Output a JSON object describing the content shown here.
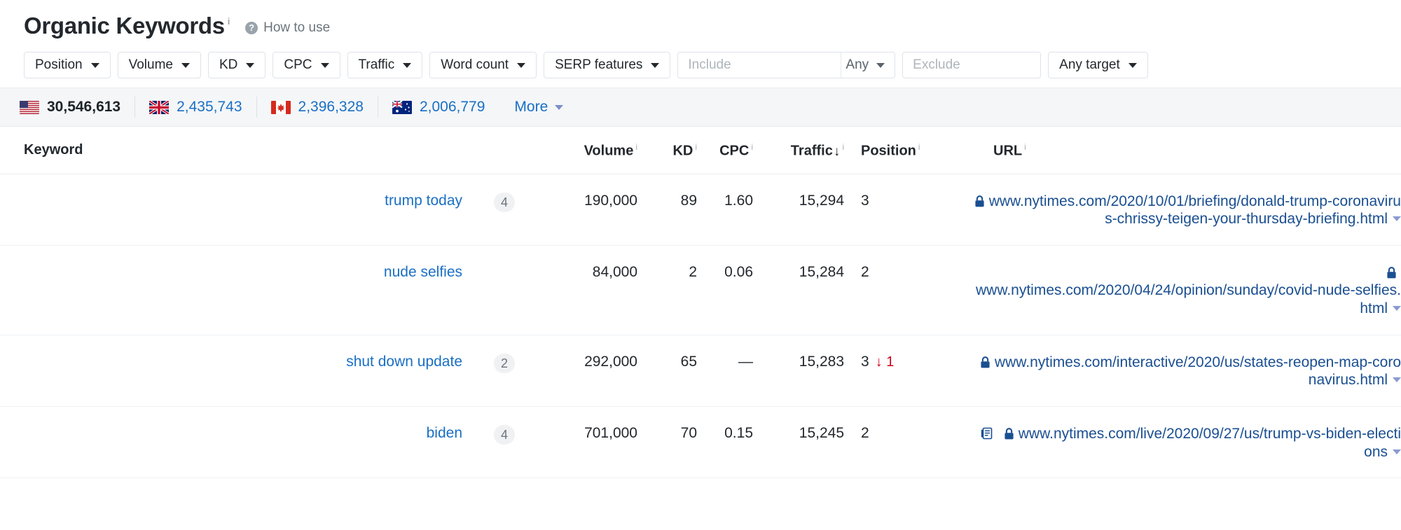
{
  "header": {
    "title": "Organic Keywords",
    "title_info": "i",
    "how_to_use": "How to use",
    "help_icon": "question-mark-icon"
  },
  "filters": {
    "buttons": [
      {
        "label": "Position",
        "name": "position"
      },
      {
        "label": "Volume",
        "name": "volume"
      },
      {
        "label": "KD",
        "name": "kd"
      },
      {
        "label": "CPC",
        "name": "cpc"
      },
      {
        "label": "Traffic",
        "name": "traffic"
      },
      {
        "label": "Word count",
        "name": "word-count"
      },
      {
        "label": "SERP features",
        "name": "serp-features"
      }
    ],
    "include": {
      "placeholder": "Include",
      "value": "",
      "mode": "Any"
    },
    "exclude": {
      "placeholder": "Exclude",
      "value": ""
    },
    "target": {
      "label": "Any target"
    }
  },
  "countries": {
    "items": [
      {
        "code": "US",
        "flag": "flag-us-icon",
        "count": "30,546,613",
        "active": true
      },
      {
        "code": "UK",
        "flag": "flag-uk-icon",
        "count": "2,435,743",
        "active": false
      },
      {
        "code": "CA",
        "flag": "flag-ca-icon",
        "count": "2,396,328",
        "active": false
      },
      {
        "code": "AU",
        "flag": "flag-au-icon",
        "count": "2,006,779",
        "active": false
      }
    ],
    "more_label": "More"
  },
  "table": {
    "columns": {
      "keyword": "Keyword",
      "volume": "Volume",
      "kd": "KD",
      "cpc": "CPC",
      "traffic": "Traffic",
      "position": "Position",
      "url": "URL"
    },
    "sort": {
      "column": "traffic",
      "direction": "desc",
      "glyph": "↓"
    },
    "info_glyph": "i",
    "rows": [
      {
        "keyword": "trump today",
        "word_count": "4",
        "volume": "190,000",
        "kd": "89",
        "cpc": "1.60",
        "traffic": "15,294",
        "position": "3",
        "position_change": "",
        "url": "www.nytimes.com/2020/10/01/briefing/donald-trump-coronavirus-chrissy-teigen-your-thursday-briefing.html",
        "secure": true,
        "serp_feature_icon": "",
        "lock_inline": true
      },
      {
        "keyword": "nude selfies",
        "word_count": "",
        "volume": "84,000",
        "kd": "2",
        "cpc": "0.06",
        "traffic": "15,284",
        "position": "2",
        "position_change": "",
        "url": "www.nytimes.com/2020/04/24/opinion/sunday/covid-nude-selfies.html",
        "secure": true,
        "serp_feature_icon": "",
        "lock_inline": false
      },
      {
        "keyword": "shut down update",
        "word_count": "2",
        "volume": "292,000",
        "kd": "65",
        "cpc": "—",
        "traffic": "15,283",
        "position": "3",
        "position_change": "↓ 1",
        "url": "www.nytimes.com/interactive/2020/us/states-reopen-map-coronavirus.html",
        "secure": true,
        "serp_feature_icon": "",
        "lock_inline": true
      },
      {
        "keyword": "biden",
        "word_count": "4",
        "volume": "701,000",
        "kd": "70",
        "cpc": "0.15",
        "traffic": "15,245",
        "position": "2",
        "position_change": "",
        "url": "www.nytimes.com/live/2020/09/27/us/trump-vs-biden-elections",
        "secure": true,
        "serp_feature_icon": "top-stories-icon",
        "lock_inline": true
      }
    ]
  },
  "colors": {
    "link": "#1a6fc4",
    "url_link": "#1a4f91",
    "drop": "#d0021b",
    "bar_bg": "#f4f6f8",
    "border": "#e9edf0"
  }
}
